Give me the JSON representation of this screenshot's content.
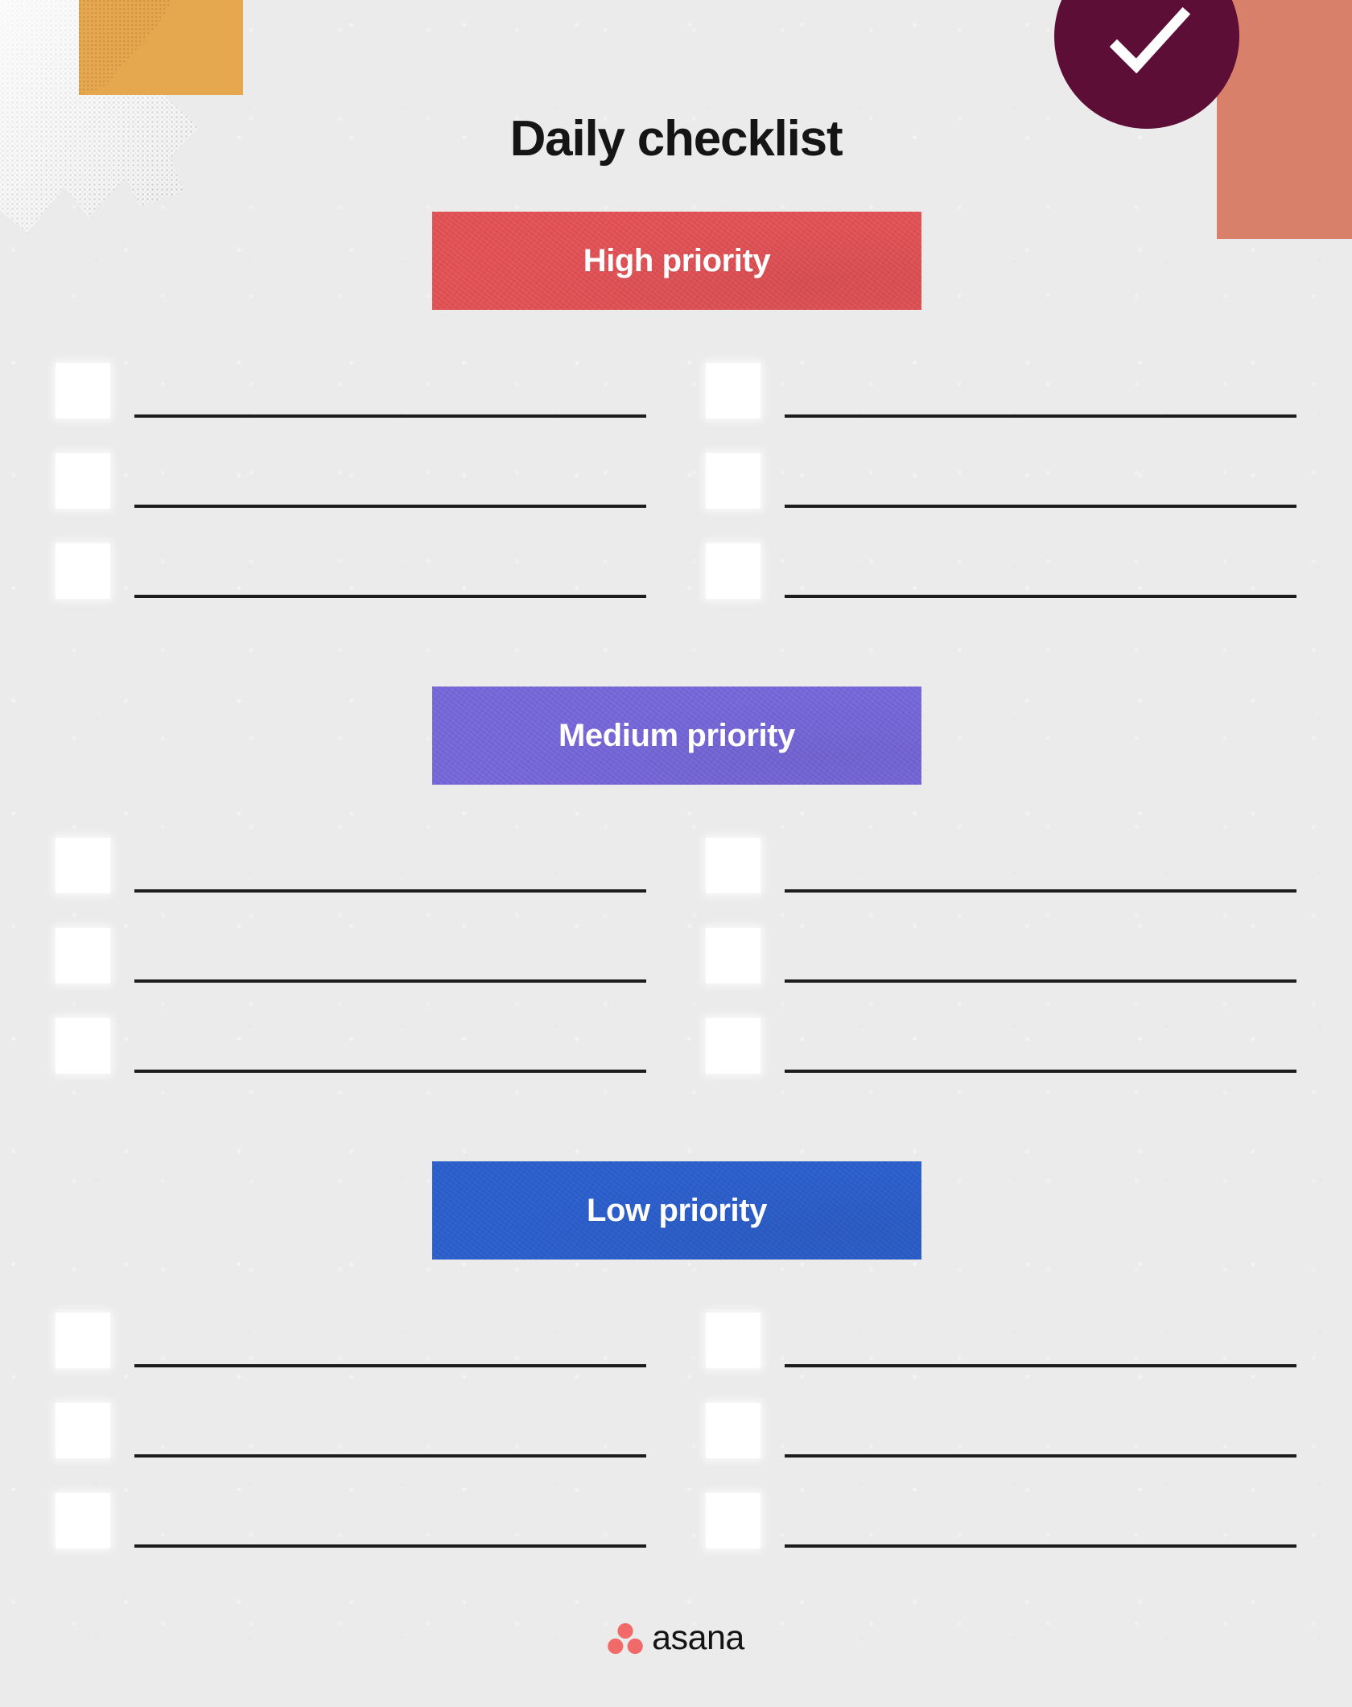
{
  "page": {
    "title": "Daily checklist",
    "background_color": "#ebebeb"
  },
  "decorations": {
    "amber_rect": {
      "name": "amber-rectangle",
      "color": "#e5a84f"
    },
    "coral_rect": {
      "name": "coral-rectangle",
      "color": "#d9806a"
    },
    "check_circle": {
      "name": "check-badge",
      "color": "#5c0e37",
      "icon": "check-icon",
      "check_color": "#ffffff"
    },
    "torn_paper": {
      "name": "torn-paper-texture",
      "color": "#c9c9c9"
    }
  },
  "sections": [
    {
      "id": "high",
      "label": "High priority",
      "color": "#e8565a",
      "label_color": "#ffffff",
      "columns": [
        {
          "rows": [
            {
              "checked": false
            },
            {
              "checked": false
            },
            {
              "checked": false
            }
          ]
        },
        {
          "rows": [
            {
              "checked": false
            },
            {
              "checked": false
            },
            {
              "checked": false
            }
          ]
        }
      ]
    },
    {
      "id": "medium",
      "label": "Medium priority",
      "color": "#7b6ce0",
      "label_color": "#ffffff",
      "columns": [
        {
          "rows": [
            {
              "checked": false
            },
            {
              "checked": false
            },
            {
              "checked": false
            }
          ]
        },
        {
          "rows": [
            {
              "checked": false
            },
            {
              "checked": false
            },
            {
              "checked": false
            }
          ]
        }
      ]
    },
    {
      "id": "low",
      "label": "Low priority",
      "color": "#2f63d2",
      "label_color": "#ffffff",
      "columns": [
        {
          "rows": [
            {
              "checked": false
            },
            {
              "checked": false
            },
            {
              "checked": false
            }
          ]
        },
        {
          "rows": [
            {
              "checked": false
            },
            {
              "checked": false
            },
            {
              "checked": false
            }
          ]
        }
      ]
    }
  ],
  "footer": {
    "brand": "asana",
    "logo_icon": "asana-logo-icon",
    "logo_color": "#f06a6a",
    "wordmark_color": "#141414"
  }
}
